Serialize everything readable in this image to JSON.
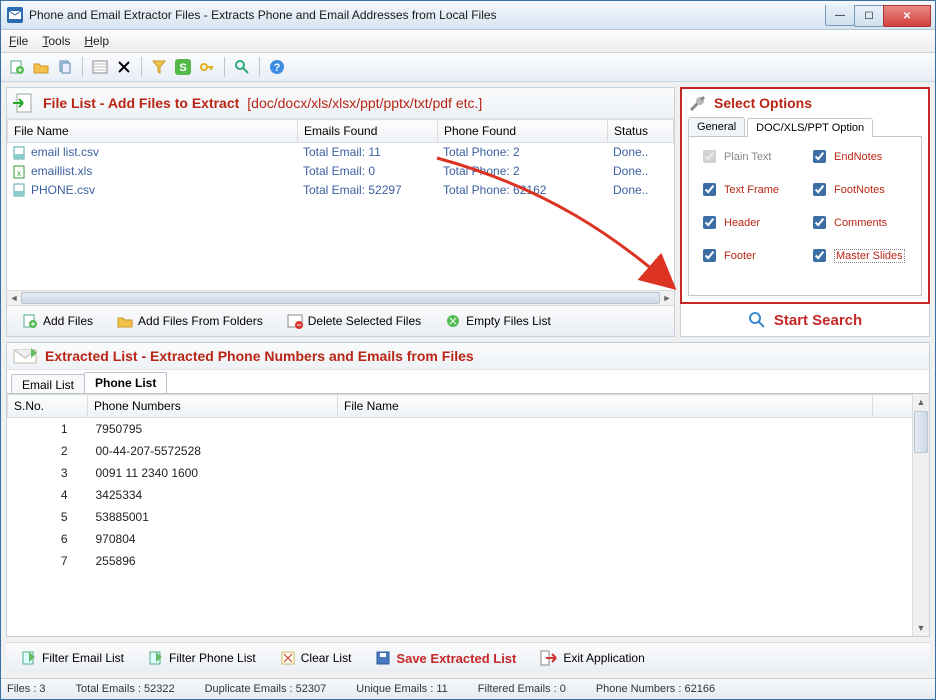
{
  "window": {
    "title": "Phone and Email Extractor Files  -  Extracts Phone and Email Addresses from Local Files"
  },
  "menu": {
    "file": "File",
    "tools": "Tools",
    "help": "Help"
  },
  "filelist": {
    "heading": "File List - Add Files to Extract",
    "heading_hint": "[doc/docx/xls/xlsx/ppt/pptx/txt/pdf etc.]",
    "cols": {
      "fname": "File Name",
      "emails": "Emails Found",
      "phone": "Phone Found",
      "status": "Status"
    },
    "rows": [
      {
        "fname": "email list.csv",
        "emails": "Total Email: 11",
        "phone": "Total Phone: 2",
        "status": "Done..",
        "icon": "csv"
      },
      {
        "fname": "emaillist.xls",
        "emails": "Total Email: 0",
        "phone": "Total Phone: 2",
        "status": "Done..",
        "icon": "xls"
      },
      {
        "fname": "PHONE.csv",
        "emails": "Total Email: 52297",
        "phone": "Total Phone: 62162",
        "status": "Done..",
        "icon": "csv"
      }
    ],
    "buttons": {
      "add": "Add Files",
      "add_folder": "Add Files From Folders",
      "delete": "Delete Selected Files",
      "empty": "Empty Files List"
    }
  },
  "options": {
    "heading": "Select Options",
    "tabs": {
      "general": "General",
      "doc": "DOC/XLS/PPT Option"
    },
    "items": {
      "plain": "Plain Text",
      "endnotes": "EndNotes",
      "textframe": "Text Frame",
      "footnotes": "FootNotes",
      "header": "Header",
      "comments": "Comments",
      "footer": "Footer",
      "master": "Master Slides"
    }
  },
  "start": "Start Search",
  "extracted": {
    "heading": "Extracted List - Extracted Phone Numbers and Emails from Files",
    "tabs": {
      "email": "Email List",
      "phone": "Phone List"
    },
    "cols": {
      "sno": "S.No.",
      "num": "Phone Numbers",
      "fname": "File Name"
    },
    "rows": [
      {
        "sno": "1",
        "num": "7950795",
        "fname": ""
      },
      {
        "sno": "2",
        "num": "00-44-207-5572528",
        "fname": ""
      },
      {
        "sno": "3",
        "num": "0091 11 2340 1600",
        "fname": ""
      },
      {
        "sno": "4",
        "num": "3425334",
        "fname": ""
      },
      {
        "sno": "5",
        "num": "53885001",
        "fname": ""
      },
      {
        "sno": "6",
        "num": "970804",
        "fname": ""
      },
      {
        "sno": "7",
        "num": "255896",
        "fname": ""
      }
    ]
  },
  "footer_buttons": {
    "filter_email": "Filter Email List",
    "filter_phone": "Filter Phone List",
    "clear": "Clear List",
    "save": "Save Extracted List",
    "exit": "Exit Application"
  },
  "status": {
    "files": "Files :  3",
    "total": "Total Emails :  52322",
    "dup": "Duplicate Emails :  52307",
    "unique": "Unique Emails :  11",
    "filtered": "Filtered Emails :  0",
    "phone": "Phone Numbers :  62166"
  }
}
